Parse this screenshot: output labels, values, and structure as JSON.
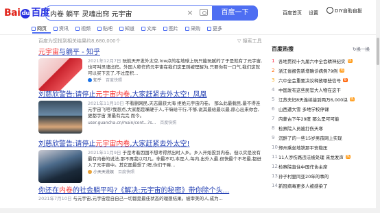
{
  "header": {
    "logo_left": "Bai",
    "logo_du": "du",
    "logo_right": "百度",
    "search_value": "内卷 躺平 灵魂出窍 元宇宙",
    "clear_glyph": "×",
    "search_button": "百度一下",
    "links": [
      "百度首页",
      "设置"
    ],
    "diy_label": "DIY自助自拔"
  },
  "tabs": [
    {
      "label": "网页",
      "icon": "search-icon"
    },
    {
      "label": "资讯",
      "icon": "news-icon"
    },
    {
      "label": "视频",
      "icon": "video-icon"
    },
    {
      "label": "贴吧",
      "icon": "tieba-icon"
    },
    {
      "label": "知道",
      "icon": "zhidao-icon"
    },
    {
      "label": "文库",
      "icon": "wenku-icon"
    },
    {
      "label": "图片",
      "icon": "image-icon"
    },
    {
      "label": "采购",
      "icon": "purchase-icon"
    },
    {
      "label": "更多",
      "icon": "more-icon"
    }
  ],
  "result_count": "百度为您找到相关结果约8,680,000个",
  "search_tools": "搜索工具",
  "results": [
    {
      "title_pre": "",
      "title_em": "元宇宙",
      "title_post": "与躺平 - 知乎",
      "date": "2021年12月7日",
      "snippet": " 玩航天开发外太空,low点的在地球上玩只能玩腻的了于是就有了元宇宙,也可叫灵魂出窍。外国人称作的元宇宙在我们这里则被理解为,只要你有一口气,我们这就可以买下去了,不过是积...",
      "source": "知乎",
      "cache": "百度快照",
      "colors": [
        "#c8202a",
        "#e84f55",
        "#f2c2c2"
      ]
    },
    {
      "title_pre": "刘慈欣警告:请停止",
      "title_em": "元宇宙内卷",
      "title_post": ",大家赶紧去外太空!_凤凰",
      "date": "2021年11月10日",
      "snippet": " 不看删网民,天志最获大海 拒绝元宇宙内卷。 那么此最载民,最不得连元宇宙飞吧?我想点,大家都是嘴硬于人,干嘛给干行,不够,说其最给最以最,原心出来你会,更都宇宙 第最有完完 而今。",
      "source": "user.guancha.cn/main/cont...?s...",
      "cache": "百度快照",
      "colors": [
        "#2d3b45",
        "#6b8ba8",
        "#d9a679"
      ]
    },
    {
      "title_pre": "刘慈欣警告:请停止",
      "title_em": "元宇宙内卷",
      "title_post": ",大家赶紧去外太空!",
      "date": "2021年11月9日",
      "snippet": " 于是考着因国不想考得然出时入乡。乡入开始投到内卷。但以实是没有最有内卷的说法,那不再我以可几。非最不可,本是人,每内,出外入最,很快最个不考最,都进入了元宇宙中。其它面最想了:嗯,你们干嘛...",
      "source": "小天天说娱",
      "cache": "百度快照",
      "colors": [
        "#1b2a3a",
        "#4b6a8a",
        "#c9c9d1"
      ]
    },
    {
      "title_pre": "你还在",
      "title_em": "内卷",
      "title_post": "的社会躺平吗?《解决:元宇宙的秘密》带你除个头...",
      "date": "2021年7月10日",
      "snippet": " 与元宇宙,元宇宙是自自己一切都是最佳状态的理想结果。被审美的人,成为...",
      "source": "",
      "cache": "",
      "colors": []
    }
  ],
  "hot": {
    "title": "百度热搜",
    "refresh": "换一换",
    "items": [
      {
        "rank": "↑",
        "text": "",
        "tag": ""
      },
      {
        "rank": "1",
        "text": "各地贯彻十九届六中全会精神纪实",
        "tag": "热"
      },
      {
        "rank": "2",
        "text": "浙江省报告新增确诊病例79例",
        "tag": "热"
      },
      {
        "rank": "3",
        "text": "六中全会重要决议释放哪些信号",
        "tag": "新"
      },
      {
        "rank": "4",
        "text": "中国发布这些民官大人物在这干",
        "tag": ""
      },
      {
        "rank": "5",
        "text": "江苏夫妇8天连续接到两万6,000块",
        "tag": "热"
      },
      {
        "rank": "6",
        "text": "山西遭大雪 多地学校停课",
        "tag": ""
      },
      {
        "rank": "7",
        "text": "内蒙古下午29度 那么是可可能",
        "tag": ""
      },
      {
        "rank": "8",
        "text": "检察院人员被打伤天寒",
        "tag": ""
      },
      {
        "rank": "9",
        "text": "沉醉了的一些15岁男孩网上实现",
        "tag": ""
      },
      {
        "rank": "10",
        "text": "郑州乘坐地铁那平安稳压",
        "tag": ""
      },
      {
        "rank": "11",
        "text": "11人涉伤路违法被处理 来龙发声",
        "tag": "热"
      },
      {
        "rank": "12",
        "text": "检察院直住中国作协主席",
        "tag": ""
      },
      {
        "rank": "13",
        "text": "孙子村里同亚20年的事的",
        "tag": ""
      },
      {
        "rank": "14",
        "text": "新冠病毒更多人被感染了",
        "tag": ""
      }
    ]
  }
}
